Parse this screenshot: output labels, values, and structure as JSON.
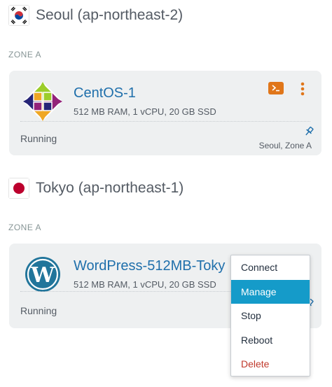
{
  "regions": [
    {
      "flag_icon": "south-korea-flag-icon",
      "title": "Seoul (ap-northeast-2)",
      "zone_label": "ZONE A",
      "instance": {
        "logo_icon": "centos-logo-icon",
        "name": "CentOS-1",
        "specs": "512 MB RAM, 1 vCPU, 20 GB SSD",
        "status": "Running",
        "location": "Seoul, Zone A"
      }
    },
    {
      "flag_icon": "japan-flag-icon",
      "title": "Tokyo (ap-northeast-1)",
      "zone_label": "ZONE A",
      "instance": {
        "logo_icon": "wordpress-logo-icon",
        "name": "WordPress-512MB-Toky",
        "specs": "512 MB RAM, 1 vCPU, 20 GB SSD",
        "status": "Running",
        "location": ""
      }
    }
  ],
  "context_menu": {
    "items": [
      {
        "label": "Connect",
        "state": "normal"
      },
      {
        "label": "Manage",
        "state": "highlighted"
      },
      {
        "label": "Stop",
        "state": "normal"
      },
      {
        "label": "Reboot",
        "state": "normal"
      },
      {
        "label": "Delete",
        "state": "danger"
      }
    ]
  },
  "colors": {
    "accent_orange": "#e0761a",
    "link_blue": "#1f6fab",
    "menu_highlight": "#159bc9",
    "danger_red": "#c0392b",
    "card_bg": "#eef0f1"
  }
}
